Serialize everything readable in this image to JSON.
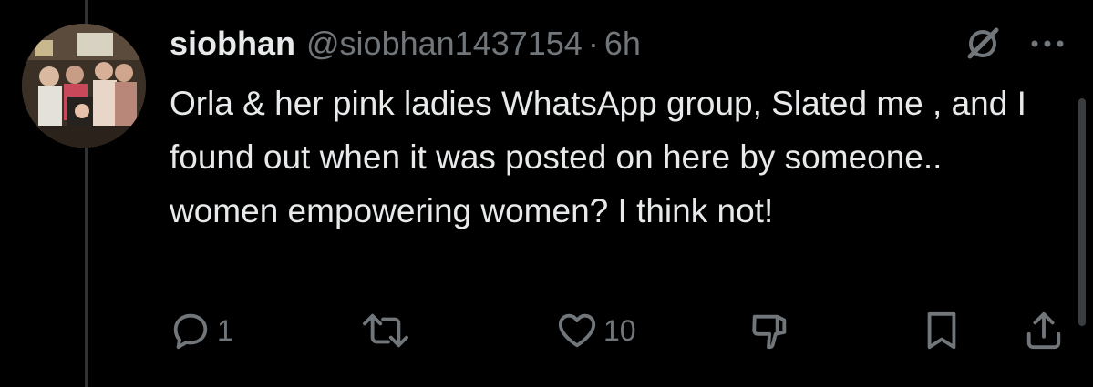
{
  "tweet": {
    "author": {
      "display_name": "siobhan",
      "handle": "@siobhan1437154",
      "separator": "·",
      "time": "6h"
    },
    "text": "Orla & her pink ladies WhatsApp group, Slated me , and I found out when it was posted on here by someone.. women empowering women? I think not!",
    "actions": {
      "reply": {
        "icon": "reply-icon",
        "count": "1"
      },
      "repost": {
        "icon": "repost-icon",
        "count": ""
      },
      "like": {
        "icon": "heart-icon",
        "count": "10"
      },
      "downvote": {
        "icon": "thumbs-down-icon"
      },
      "bookmark": {
        "icon": "bookmark-icon"
      },
      "share": {
        "icon": "share-icon"
      }
    },
    "header_icons": [
      "grok-icon",
      "more-icon"
    ]
  },
  "colors": {
    "background": "#000000",
    "text": "#e7e9ea",
    "secondary": "#71767b",
    "thread_line": "#2f3336"
  }
}
